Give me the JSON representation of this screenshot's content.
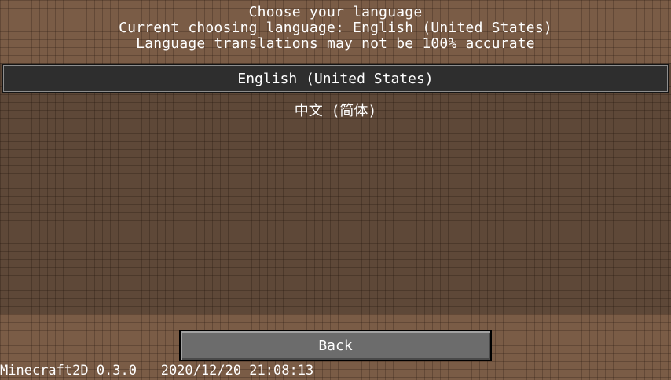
{
  "header": {
    "title": "Choose your language",
    "current": "Current choosing language: English (United States)",
    "disclaimer": "Language translations may not be 100% accurate"
  },
  "languages": [
    {
      "label": "English (United States)",
      "selected": true
    },
    {
      "label": "中文 (简体)",
      "selected": false
    }
  ],
  "buttons": {
    "back_label": "Back"
  },
  "footer": {
    "version": "Minecraft2D 0.3.0",
    "datetime": "2020/12/20 21:08:13"
  },
  "colors": {
    "background": "#7a5c46",
    "list_panel": "#5e4838",
    "selected_item": "#2e2e2e",
    "button": "#6c6c6c",
    "text": "#ffffff"
  }
}
